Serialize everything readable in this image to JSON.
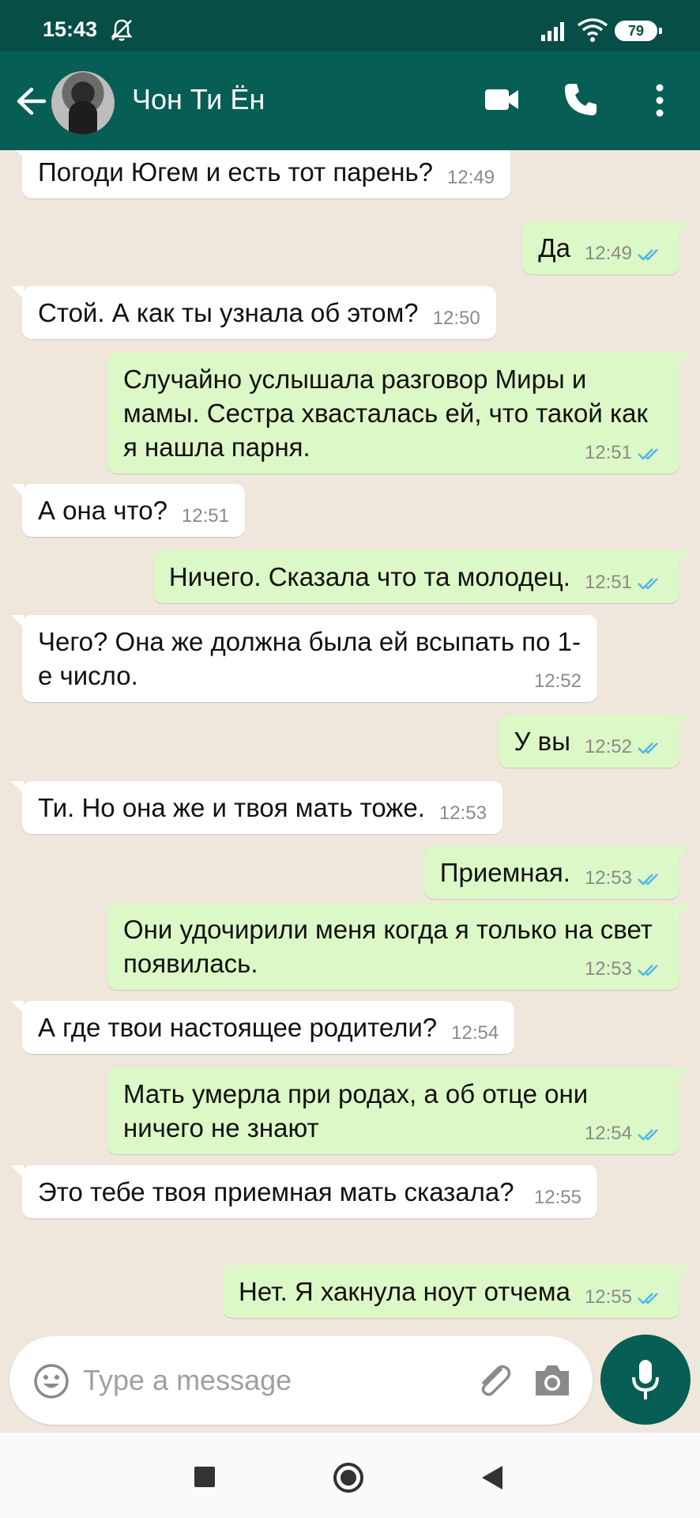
{
  "status_bar": {
    "time": "15:43",
    "battery": "79"
  },
  "header": {
    "contact_name": "Чон Ти Ён"
  },
  "messages": [
    {
      "dir": "in",
      "text": "Погоди Югем и есть тот парень?",
      "time": "12:49"
    },
    {
      "dir": "out",
      "text": "Да",
      "time": "12:49"
    },
    {
      "dir": "in",
      "text": "Стой. А как ты узнала об этом?",
      "time": "12:50"
    },
    {
      "dir": "out",
      "text": "Случайно услышала разговор Миры и мамы.  Сестра хвасталась ей, что такой как я нашла парня.",
      "time": "12:51"
    },
    {
      "dir": "in",
      "text": "А она что?",
      "time": "12:51"
    },
    {
      "dir": "out",
      "text": "Ничего. Сказала что та молодец.",
      "time": "12:51"
    },
    {
      "dir": "in",
      "text": "Чего? Она же должна была ей всыпать по 1-е число.",
      "time": "12:52"
    },
    {
      "dir": "out",
      "text": "У вы",
      "time": "12:52"
    },
    {
      "dir": "in",
      "text": "Ти. Но она же и твоя мать тоже.",
      "time": "12:53"
    },
    {
      "dir": "out",
      "text": "Приемная.",
      "time": "12:53"
    },
    {
      "dir": "out",
      "text": "Они удочирили меня когда я только на свет появилась.",
      "time": "12:53"
    },
    {
      "dir": "in",
      "text": "А где твои настоящее родители?",
      "time": "12:54"
    },
    {
      "dir": "out",
      "text": "Мать умерла при родах, а об отце они ничего не знают",
      "time": "12:54"
    },
    {
      "dir": "in",
      "text": "Это тебе твоя приемная мать сказала?",
      "time": "12:55"
    },
    {
      "dir": "out",
      "text": "Нет. Я хакнула ноут отчема",
      "time": "12:55"
    }
  ],
  "input": {
    "placeholder": "Type a message"
  },
  "colors": {
    "header": "#075e54",
    "status_bar": "#064e46",
    "outgoing_bubble": "#dcf8c6",
    "incoming_bubble": "#ffffff",
    "read_receipt": "#4fb6ec",
    "chat_background": "#efe7dc"
  },
  "icons": [
    "back-arrow-icon",
    "video-call-icon",
    "phone-icon",
    "more-options-icon",
    "emoji-icon",
    "attach-icon",
    "camera-icon",
    "mic-icon"
  ]
}
